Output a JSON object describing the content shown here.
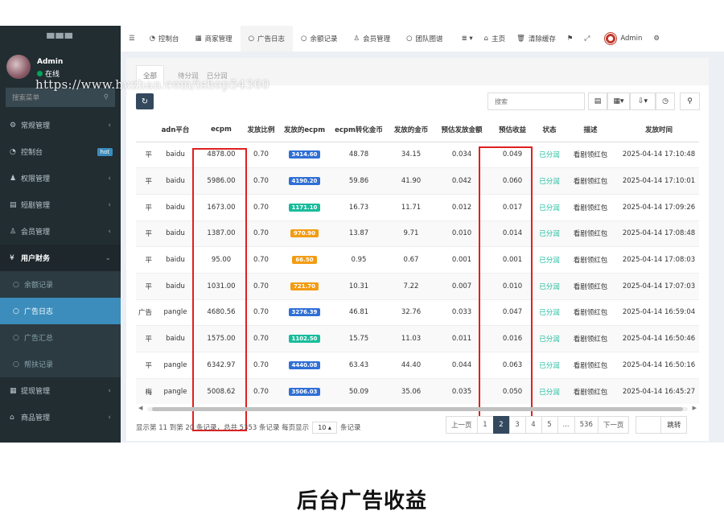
{
  "sidebar": {
    "logo": "▀▀▀",
    "user_name": "Admin",
    "user_status": "在线",
    "search_placeholder": "搜索菜单",
    "items": [
      {
        "icon": "cogs-icon",
        "glyph": "⚙",
        "label": "常规管理",
        "caret": "‹"
      },
      {
        "icon": "dashboard-icon",
        "glyph": "◔",
        "label": "控制台",
        "badge": "hot"
      },
      {
        "icon": "users-icon",
        "glyph": "👥",
        "label": "权限管理",
        "caret": "‹"
      },
      {
        "icon": "file-icon",
        "glyph": "▤",
        "label": "短剧管理",
        "caret": "‹"
      },
      {
        "icon": "user-plus-icon",
        "glyph": "👤",
        "label": "会员管理",
        "caret": "‹"
      },
      {
        "icon": "yen-icon",
        "glyph": "¥",
        "label": "用户财务",
        "caret": "⌄"
      },
      {
        "icon": "circle-icon",
        "glyph": "○",
        "label": "余额记录"
      },
      {
        "icon": "circle-icon",
        "glyph": "○",
        "label": "广告日志"
      },
      {
        "icon": "circle-icon",
        "glyph": "○",
        "label": "广告汇总"
      },
      {
        "icon": "circle-icon",
        "glyph": "○",
        "label": "帮扶记录"
      },
      {
        "icon": "list-icon",
        "glyph": "▦",
        "label": "提现管理",
        "caret": "‹"
      },
      {
        "icon": "shopping-icon",
        "glyph": "🛍",
        "label": "商品管理",
        "caret": "‹"
      }
    ]
  },
  "topbar": {
    "tabs": [
      {
        "glyph": "☰",
        "label": ""
      },
      {
        "glyph": "◔",
        "label": "控制台"
      },
      {
        "glyph": "▦",
        "label": "商家管理"
      },
      {
        "glyph": "○",
        "label": "广告日志"
      },
      {
        "glyph": "○",
        "label": "余额记录"
      },
      {
        "glyph": "👤",
        "label": "会员管理"
      },
      {
        "glyph": "○",
        "label": "团队图谱"
      }
    ],
    "more": "≣ ▾",
    "home": "主页",
    "clear_cache": "清除缓存",
    "admin": "Admin"
  },
  "panel": {
    "tabs": [
      "全部",
      "待分润",
      "已分润"
    ],
    "search_placeholder": "搜索"
  },
  "table": {
    "columns": [
      "",
      "adn平台",
      "ecpm",
      "发放比例",
      "发放的ecpm",
      "ecpm转化金币",
      "发放的金币",
      "预估发放金额",
      "预估收益",
      "状态",
      "描述",
      "发放时间"
    ],
    "rows": [
      {
        "c0": "平",
        "adn": "baidu",
        "ecpm": "4878.00",
        "ratio": "0.70",
        "issued_ecpm": "3414.60",
        "tag_color": "#2f6fd6",
        "coins": "48.78",
        "issued_coins": "34.15",
        "est_amount": "0.034",
        "est_income": "0.049",
        "status": "已分润",
        "desc": "看剧领红包",
        "time": "2025-04-14 17:10:48"
      },
      {
        "c0": "平",
        "adn": "baidu",
        "ecpm": "5986.00",
        "ratio": "0.70",
        "issued_ecpm": "4190.20",
        "tag_color": "#2f6fd6",
        "coins": "59.86",
        "issued_coins": "41.90",
        "est_amount": "0.042",
        "est_income": "0.060",
        "status": "已分润",
        "desc": "看剧领红包",
        "time": "2025-04-14 17:10:01"
      },
      {
        "c0": "平",
        "adn": "baidu",
        "ecpm": "1673.00",
        "ratio": "0.70",
        "issued_ecpm": "1171.10",
        "tag_color": "#18bc9c",
        "coins": "16.73",
        "issued_coins": "11.71",
        "est_amount": "0.012",
        "est_income": "0.017",
        "status": "已分润",
        "desc": "看剧领红包",
        "time": "2025-04-14 17:09:26"
      },
      {
        "c0": "平",
        "adn": "baidu",
        "ecpm": "1387.00",
        "ratio": "0.70",
        "issued_ecpm": "970.90",
        "tag_color": "#f39c12",
        "coins": "13.87",
        "issued_coins": "9.71",
        "est_amount": "0.010",
        "est_income": "0.014",
        "status": "已分润",
        "desc": "看剧领红包",
        "time": "2025-04-14 17:08:48"
      },
      {
        "c0": "平",
        "adn": "baidu",
        "ecpm": "95.00",
        "ratio": "0.70",
        "issued_ecpm": "66.50",
        "tag_color": "#f39c12",
        "coins": "0.95",
        "issued_coins": "0.67",
        "est_amount": "0.001",
        "est_income": "0.001",
        "status": "已分润",
        "desc": "看剧领红包",
        "time": "2025-04-14 17:08:03"
      },
      {
        "c0": "平",
        "adn": "baidu",
        "ecpm": "1031.00",
        "ratio": "0.70",
        "issued_ecpm": "721.70",
        "tag_color": "#f39c12",
        "coins": "10.31",
        "issued_coins": "7.22",
        "est_amount": "0.007",
        "est_income": "0.010",
        "status": "已分润",
        "desc": "看剧领红包",
        "time": "2025-04-14 17:07:03"
      },
      {
        "c0": "广告",
        "adn": "pangle",
        "ecpm": "4680.56",
        "ratio": "0.70",
        "issued_ecpm": "3276.39",
        "tag_color": "#2f6fd6",
        "coins": "46.81",
        "issued_coins": "32.76",
        "est_amount": "0.033",
        "est_income": "0.047",
        "status": "已分润",
        "desc": "看剧领红包",
        "time": "2025-04-14 16:59:04"
      },
      {
        "c0": "平",
        "adn": "baidu",
        "ecpm": "1575.00",
        "ratio": "0.70",
        "issued_ecpm": "1102.50",
        "tag_color": "#18bc9c",
        "coins": "15.75",
        "issued_coins": "11.03",
        "est_amount": "0.011",
        "est_income": "0.016",
        "status": "已分润",
        "desc": "看剧领红包",
        "time": "2025-04-14 16:50:46"
      },
      {
        "c0": "平",
        "adn": "pangle",
        "ecpm": "6342.97",
        "ratio": "0.70",
        "issued_ecpm": "4440.08",
        "tag_color": "#2f6fd6",
        "coins": "63.43",
        "issued_coins": "44.40",
        "est_amount": "0.044",
        "est_income": "0.063",
        "status": "已分润",
        "desc": "看剧领红包",
        "time": "2025-04-14 16:50:16"
      },
      {
        "c0": "梅",
        "adn": "pangle",
        "ecpm": "5008.62",
        "ratio": "0.70",
        "issued_ecpm": "3506.03",
        "tag_color": "#2f6fd6",
        "coins": "50.09",
        "issued_coins": "35.06",
        "est_amount": "0.035",
        "est_income": "0.050",
        "status": "已分润",
        "desc": "看剧领红包",
        "time": "2025-04-14 16:45:27"
      }
    ]
  },
  "pagination": {
    "info_prefix": "显示第 11 到第 20 条记录，总共 5353 条记录 每页显示",
    "page_size": "10 ▴",
    "info_suffix": "条记录",
    "prev": "上一页",
    "pages": [
      "1",
      "2",
      "3",
      "4",
      "5",
      "...",
      "536"
    ],
    "current": "2",
    "next": "下一页",
    "jump": "跳转"
  },
  "watermark": "https://www.huzhan.com/ishop54360",
  "caption": "后台广告收益",
  "colors": {
    "sidebar_bg": "#222d32",
    "accent": "#3c8dbc",
    "highlight": "#e02020",
    "status_green": "#18bc9c"
  }
}
